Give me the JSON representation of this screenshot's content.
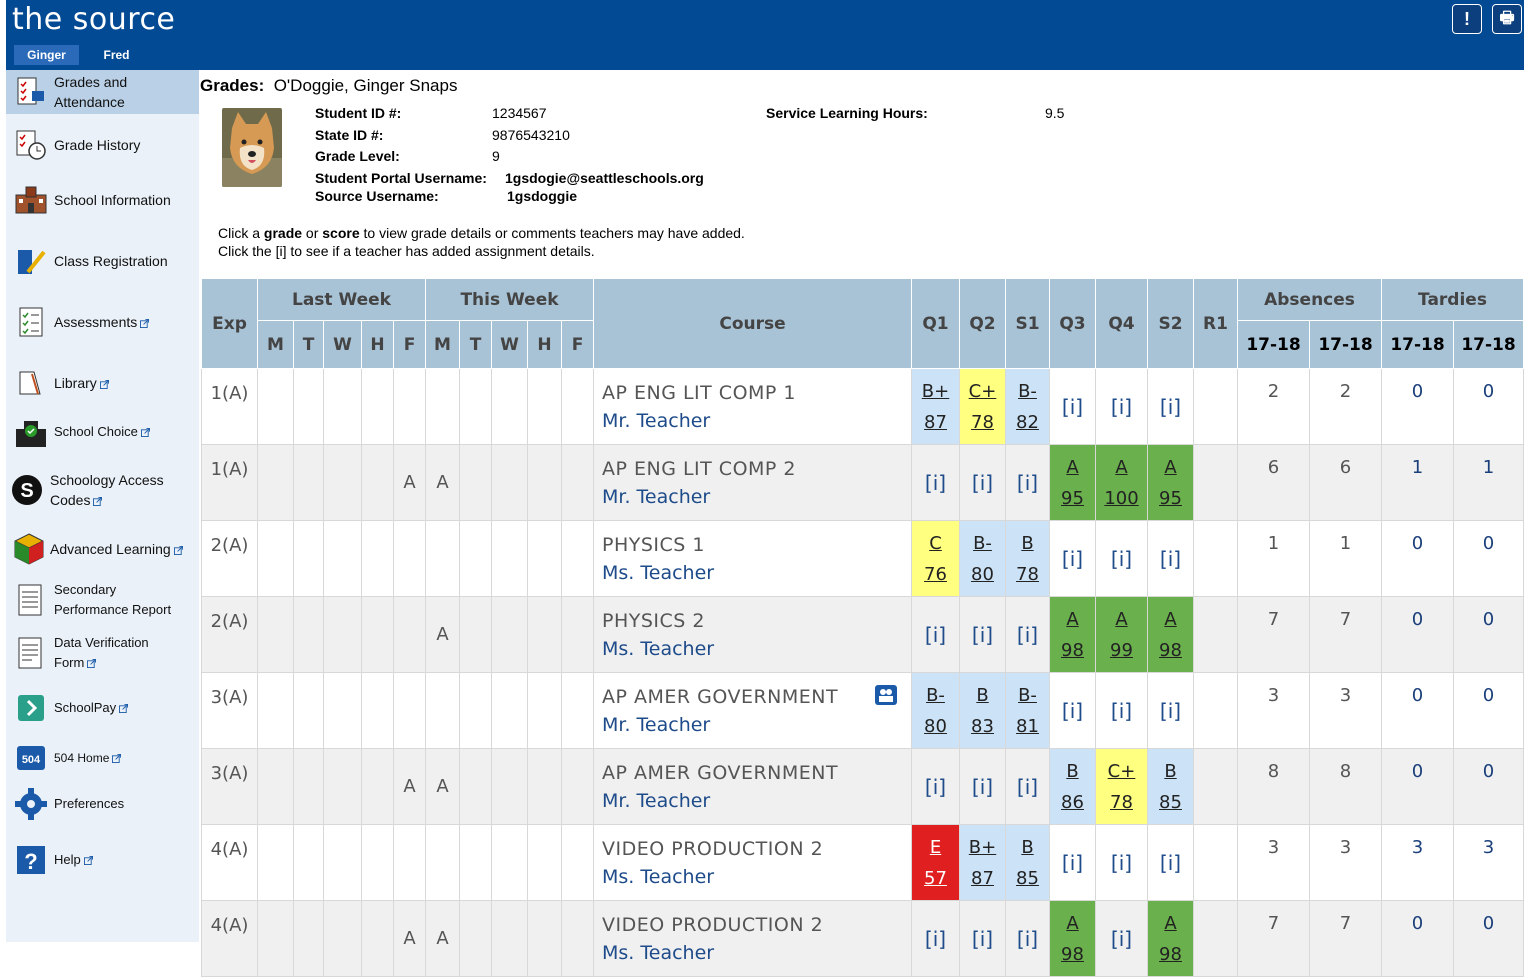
{
  "header": {
    "logo": "the source",
    "students": [
      "Ginger",
      "Fred"
    ],
    "alert_label": "!",
    "print_label": "🖶"
  },
  "sidebar": {
    "items": [
      {
        "label": "Grades and Attendance",
        "icon": "grades-attendance-icon",
        "external": false
      },
      {
        "label": "Grade History",
        "icon": "grade-history-icon",
        "external": false
      },
      {
        "label": "School Information",
        "icon": "school-icon",
        "external": false
      },
      {
        "label": "Class Registration",
        "icon": "class-registration-icon",
        "external": false
      },
      {
        "label": "Assessments",
        "icon": "assessments-icon",
        "external": true
      },
      {
        "label": "Library",
        "icon": "library-icon",
        "external": true
      },
      {
        "label": "School Choice",
        "icon": "school-choice-icon",
        "external": true
      },
      {
        "label": "Schoology Access Codes",
        "icon": "schoology-icon",
        "external": true
      },
      {
        "label": "Advanced Learning",
        "icon": "cube-icon",
        "external": true
      },
      {
        "label": "Secondary Performance Report",
        "icon": "report-icon",
        "external": false
      },
      {
        "label": "Data Verification Form",
        "icon": "form-icon",
        "external": true
      },
      {
        "label": "SchoolPay",
        "icon": "schoolpay-icon",
        "external": true
      },
      {
        "label": "504 Home",
        "icon": "504-icon",
        "external": true
      },
      {
        "label": "Preferences",
        "icon": "gear-icon",
        "external": false
      },
      {
        "label": "Help",
        "icon": "help-icon",
        "external": true
      }
    ]
  },
  "student": {
    "title_label": "Grades:",
    "name": "O'Doggie, Ginger Snaps",
    "student_id_label": "Student ID #:",
    "student_id": "1234567",
    "state_id_label": "State ID #:",
    "state_id": "9876543210",
    "grade_level_label": "Grade Level:",
    "grade_level": "9",
    "portal_username_label": "Student Portal Username:",
    "portal_username": "1gsdogie@seattleschools.org",
    "source_username_label": "Source Username:",
    "source_username": "1gsdoggie",
    "service_hours_label": "Service Learning Hours:",
    "service_hours": "9.5"
  },
  "instructions": {
    "line1_a": "Click a ",
    "line1_b": "grade",
    "line1_c": " or ",
    "line1_d": "score",
    "line1_e": " to view grade details or comments teachers may have added.",
    "line2": "Click the [i] to see if a teacher has added assignment details."
  },
  "table": {
    "headers": {
      "exp": "Exp",
      "last_week": "Last Week",
      "this_week": "This Week",
      "course": "Course",
      "q1": "Q1",
      "q2": "Q2",
      "s1": "S1",
      "q3": "Q3",
      "q4": "Q4",
      "s2": "S2",
      "r1": "R1",
      "absences": "Absences",
      "tardies": "Tardies",
      "days": [
        "M",
        "T",
        "W",
        "H",
        "F"
      ],
      "year": "17-18"
    },
    "rows": [
      {
        "exp": "1(A)",
        "last": [
          "",
          "",
          "",
          "",
          ""
        ],
        "this": [
          "",
          "",
          "",
          "",
          ""
        ],
        "course": "AP ENG LIT COMP 1",
        "teacher": "Mr. Teacher",
        "badge": false,
        "grades": [
          {
            "g": "B+",
            "s": "87",
            "c": "blue"
          },
          {
            "g": "C+",
            "s": "78",
            "c": "yellow"
          },
          {
            "g": "B-",
            "s": "82",
            "c": "blue"
          },
          {
            "i": "[i]"
          },
          {
            "i": "[i]"
          },
          {
            "i": "[i]"
          },
          {
            "e": ""
          }
        ],
        "abs": [
          "2",
          "2"
        ],
        "tar": [
          "0",
          "0"
        ]
      },
      {
        "exp": "1(A)",
        "last": [
          "",
          "",
          "",
          "",
          "A"
        ],
        "this": [
          "A",
          "",
          "",
          "",
          ""
        ],
        "course": "AP ENG LIT COMP 2",
        "teacher": "Mr. Teacher",
        "badge": false,
        "grades": [
          {
            "i": "[i]"
          },
          {
            "i": "[i]"
          },
          {
            "i": "[i]"
          },
          {
            "g": "A",
            "s": "95",
            "c": "green"
          },
          {
            "g": "A",
            "s": "100",
            "c": "green"
          },
          {
            "g": "A",
            "s": "95",
            "c": "green"
          },
          {
            "e": ""
          }
        ],
        "abs": [
          "6",
          "6"
        ],
        "tar": [
          "1",
          "1"
        ]
      },
      {
        "exp": "2(A)",
        "last": [
          "",
          "",
          "",
          "",
          ""
        ],
        "this": [
          "",
          "",
          "",
          "",
          ""
        ],
        "course": "PHYSICS 1",
        "teacher": "Ms. Teacher",
        "badge": false,
        "grades": [
          {
            "g": "C",
            "s": "76",
            "c": "yellow"
          },
          {
            "g": "B-",
            "s": "80",
            "c": "blue"
          },
          {
            "g": "B",
            "s": "78",
            "c": "blue"
          },
          {
            "i": "[i]"
          },
          {
            "i": "[i]"
          },
          {
            "i": "[i]"
          },
          {
            "e": ""
          }
        ],
        "abs": [
          "1",
          "1"
        ],
        "tar": [
          "0",
          "0"
        ]
      },
      {
        "exp": "2(A)",
        "last": [
          "",
          "",
          "",
          "",
          ""
        ],
        "this": [
          "A",
          "",
          "",
          "",
          ""
        ],
        "course": "PHYSICS 2",
        "teacher": "Ms. Teacher",
        "badge": false,
        "grades": [
          {
            "i": "[i]"
          },
          {
            "i": "[i]"
          },
          {
            "i": "[i]"
          },
          {
            "g": "A",
            "s": "98",
            "c": "green"
          },
          {
            "g": "A",
            "s": "99",
            "c": "green"
          },
          {
            "g": "A",
            "s": "98",
            "c": "green"
          },
          {
            "e": ""
          }
        ],
        "abs": [
          "7",
          "7"
        ],
        "tar": [
          "0",
          "0"
        ]
      },
      {
        "exp": "3(A)",
        "last": [
          "",
          "",
          "",
          "",
          ""
        ],
        "this": [
          "",
          "",
          "",
          "",
          ""
        ],
        "course": "AP AMER GOVERNMENT",
        "teacher": "Mr. Teacher",
        "badge": true,
        "grades": [
          {
            "g": "B-",
            "s": "80",
            "c": "blue"
          },
          {
            "g": "B",
            "s": "83",
            "c": "blue"
          },
          {
            "g": "B-",
            "s": "81",
            "c": "blue"
          },
          {
            "i": "[i]"
          },
          {
            "i": "[i]"
          },
          {
            "i": "[i]"
          },
          {
            "e": ""
          }
        ],
        "abs": [
          "3",
          "3"
        ],
        "tar": [
          "0",
          "0"
        ]
      },
      {
        "exp": "3(A)",
        "last": [
          "",
          "",
          "",
          "",
          "A"
        ],
        "this": [
          "A",
          "",
          "",
          "",
          ""
        ],
        "course": "AP AMER GOVERNMENT",
        "teacher": "Mr. Teacher",
        "badge": false,
        "grades": [
          {
            "i": "[i]"
          },
          {
            "i": "[i]"
          },
          {
            "i": "[i]"
          },
          {
            "g": "B",
            "s": "86",
            "c": "blue"
          },
          {
            "g": "C+",
            "s": "78",
            "c": "yellow"
          },
          {
            "g": "B",
            "s": "85",
            "c": "blue"
          },
          {
            "e": ""
          }
        ],
        "abs": [
          "8",
          "8"
        ],
        "tar": [
          "0",
          "0"
        ]
      },
      {
        "exp": "4(A)",
        "last": [
          "",
          "",
          "",
          "",
          ""
        ],
        "this": [
          "",
          "",
          "",
          "",
          ""
        ],
        "course": "VIDEO PRODUCTION 2",
        "teacher": "Ms. Teacher",
        "badge": false,
        "grades": [
          {
            "g": "E",
            "s": "57",
            "c": "red"
          },
          {
            "g": "B+",
            "s": "87",
            "c": "blue"
          },
          {
            "g": "B",
            "s": "85",
            "c": "blue"
          },
          {
            "i": "[i]"
          },
          {
            "i": "[i]"
          },
          {
            "i": "[i]"
          },
          {
            "e": ""
          }
        ],
        "abs": [
          "3",
          "3"
        ],
        "tar": [
          "3",
          "3"
        ]
      },
      {
        "exp": "4(A)",
        "last": [
          "",
          "",
          "",
          "",
          "A"
        ],
        "this": [
          "A",
          "",
          "",
          "",
          ""
        ],
        "course": "VIDEO PRODUCTION 2",
        "teacher": "Ms. Teacher",
        "badge": false,
        "grades": [
          {
            "i": "[i]"
          },
          {
            "i": "[i]"
          },
          {
            "i": "[i]"
          },
          {
            "g": "A",
            "s": "98",
            "c": "green"
          },
          {
            "i": "[i]"
          },
          {
            "g": "A",
            "s": "98",
            "c": "green"
          },
          {
            "e": ""
          }
        ],
        "abs": [
          "7",
          "7"
        ],
        "tar": [
          "0",
          "0"
        ]
      }
    ]
  },
  "colors": {
    "header_bg": "#034a95",
    "grade_green": "#6ab04c",
    "grade_yellow": "#ffff80",
    "grade_blue": "#cce3f7",
    "grade_red": "#e02020",
    "table_header": "#a8c2d6"
  }
}
